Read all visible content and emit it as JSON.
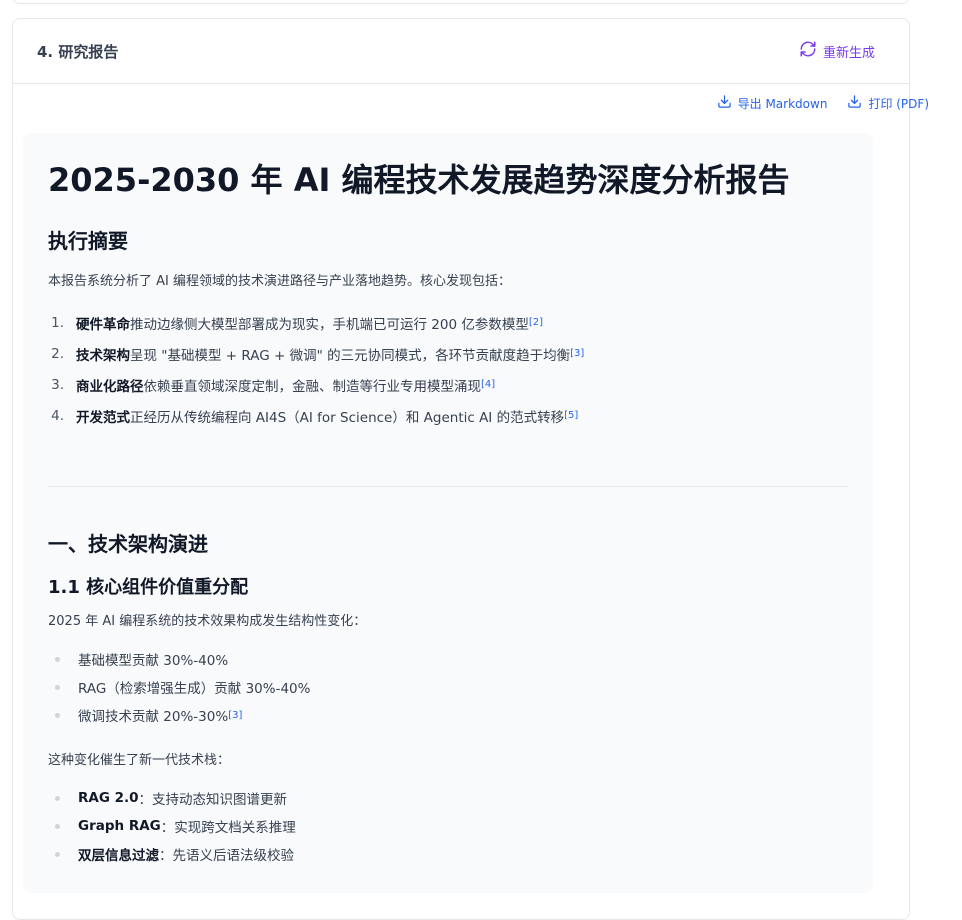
{
  "card": {
    "title": "4. 研究报告",
    "regenerate_label": "重新生成"
  },
  "toolbar": {
    "export_markdown_label": "导出 Markdown",
    "print_pdf_label": "打印 (PDF)"
  },
  "report": {
    "title": "2025-2030 年 AI 编程技术发展趋势深度分析报告",
    "summary_heading": "执行摘要",
    "summary_intro": "本报告系统分析了 AI 编程领域的技术演进路径与产业落地趋势。核心发现包括：",
    "findings": [
      {
        "num": "1.",
        "bold": "硬件革命",
        "text": "推动边缘侧大模型部署成为现实，手机端已可运行 200 亿参数模型",
        "ref": "[2]"
      },
      {
        "num": "2.",
        "bold": "技术架构",
        "text": "呈现 \"基础模型 + RAG + 微调\" 的三元协同模式，各环节贡献度趋于均衡",
        "ref": "[3]"
      },
      {
        "num": "3.",
        "bold": "商业化路径",
        "text": "依赖垂直领域深度定制，金融、制造等行业专用模型涌现",
        "ref": "[4]"
      },
      {
        "num": "4.",
        "bold": "开发范式",
        "text": "正经历从传统编程向 AI4S（AI for Science）和 Agentic AI 的范式转移",
        "ref": "[5]"
      }
    ],
    "section1_heading": "一、技术架构演进",
    "section1_1_heading": "1.1 核心组件价值重分配",
    "section1_1_intro": "2025 年 AI 编程系统的技术效果构成发生结构性变化：",
    "components": [
      {
        "text": "基础模型贡献 30%-40%",
        "ref": ""
      },
      {
        "text": "RAG（检索增强生成）贡献 30%-40%",
        "ref": ""
      },
      {
        "text": "微调技术贡献 20%-30% ",
        "ref": "[3]"
      }
    ],
    "stack_intro": "这种变化催生了新一代技术栈：",
    "stack": [
      {
        "bold": "RAG 2.0",
        "text": "：支持动态知识图谱更新"
      },
      {
        "bold": "Graph RAG",
        "text": "：实现跨文档关系推理"
      },
      {
        "bold": "双层信息过滤",
        "text": "：先语义后语法级校验"
      }
    ]
  },
  "colors": {
    "regenerate": "#7c3aed",
    "toolbar_link": "#2563eb",
    "report_bg": "#f9fafb",
    "border": "#e5e7eb"
  },
  "icons": [
    "refresh-icon",
    "download-icon",
    "download-icon"
  ]
}
